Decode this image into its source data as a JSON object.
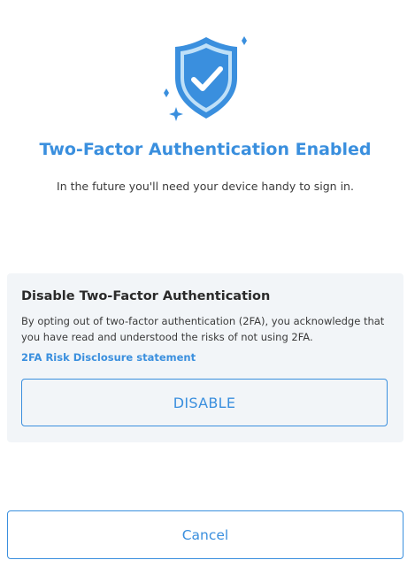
{
  "hero": {
    "icon": "shield-check-icon",
    "sparkles": [
      "sparkle-icon",
      "sparkle-icon",
      "sparkle-icon"
    ],
    "accent_color": "#3a8fde",
    "light_color": "#bfe0f8"
  },
  "header": {
    "title": "Two-Factor Authentication Enabled",
    "subtitle": "In the future you'll need your device handy to sign in."
  },
  "disable_section": {
    "heading": "Disable Two-Factor Authentication",
    "body": "By opting out of two-factor authentication (2FA), you acknowledge that you have read and understood the risks of not using 2FA.",
    "link_label": "2FA Risk Disclosure statement",
    "button_label": "DISABLE",
    "background_color": "#f2f5f8"
  },
  "footer": {
    "cancel_label": "Cancel"
  }
}
